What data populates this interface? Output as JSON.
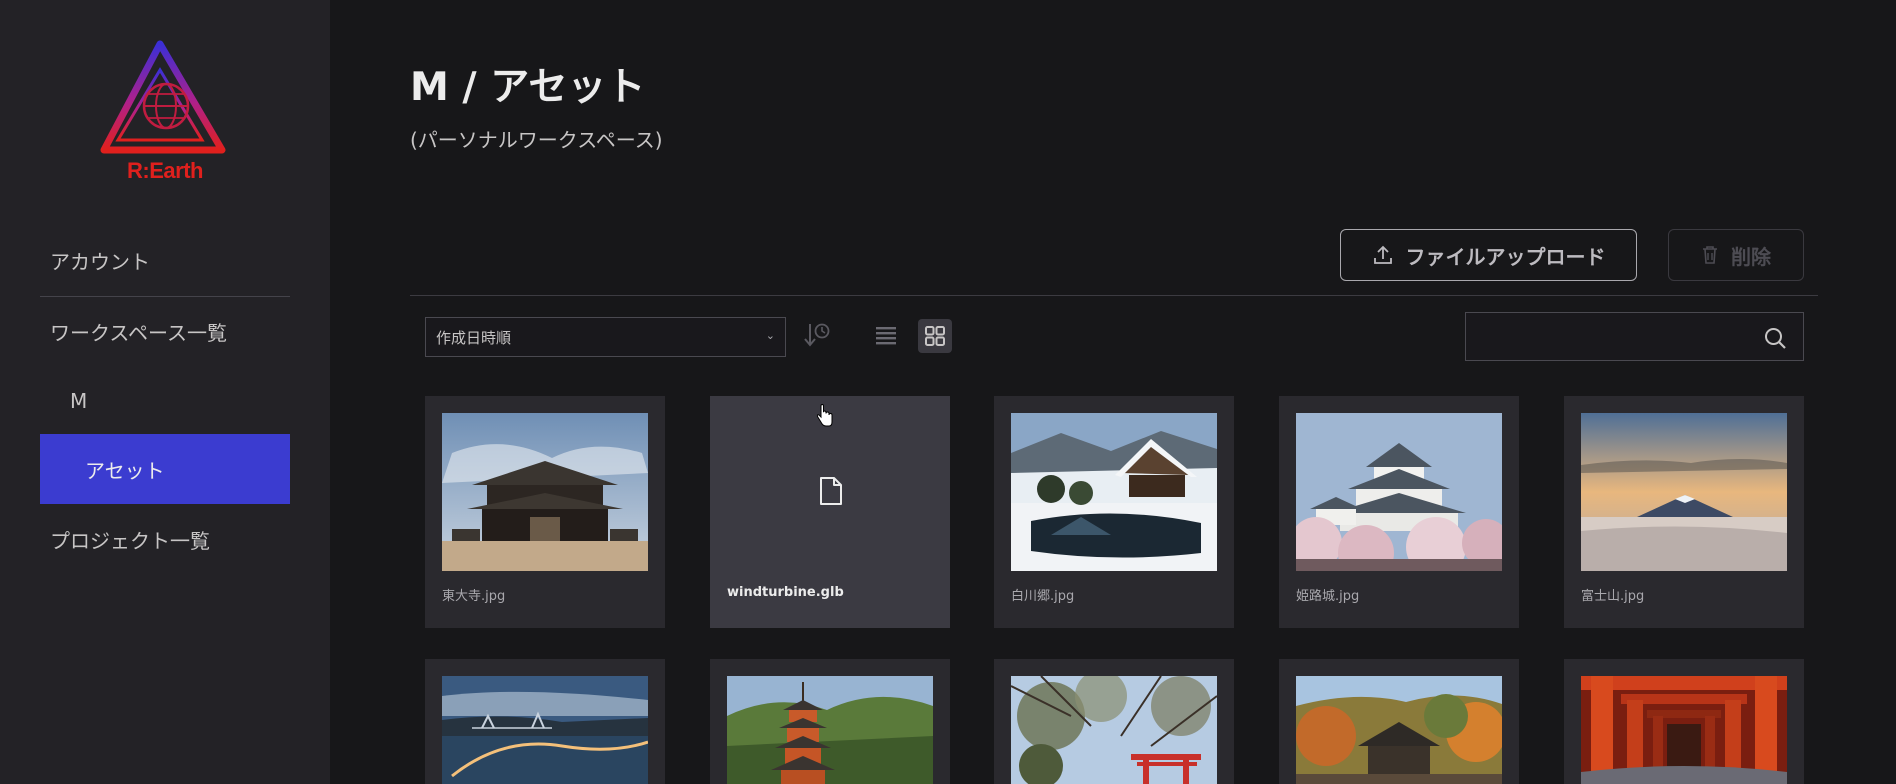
{
  "sidebar": {
    "logo_text": "R:Earth",
    "items": [
      {
        "label": "アカウント"
      },
      {
        "label": "ワークスペース一覧"
      },
      {
        "label": "M"
      },
      {
        "label": "アセット"
      },
      {
        "label": "プロジェクト一覧"
      }
    ]
  },
  "header": {
    "title": "M / アセット",
    "subtitle": "(パーソナルワークスペース)"
  },
  "actions": {
    "upload_label": "ファイルアップロード",
    "delete_label": "削除"
  },
  "toolbar": {
    "sort_value": "作成日時順",
    "search_value": ""
  },
  "assets": [
    {
      "name": "東大寺.jpg",
      "icon": "temple-photo"
    },
    {
      "name": "windturbine.glb",
      "icon": "file-icon"
    },
    {
      "name": "白川郷.jpg",
      "icon": "snow-village-photo"
    },
    {
      "name": "姫路城.jpg",
      "icon": "castle-photo"
    },
    {
      "name": "富士山.jpg",
      "icon": "mountain-photo"
    },
    {
      "name": "",
      "icon": "bridge-photo"
    },
    {
      "name": "",
      "icon": "pagoda-photo"
    },
    {
      "name": "",
      "icon": "shrine-gate-photo"
    },
    {
      "name": "",
      "icon": "autumn-temple-photo"
    },
    {
      "name": "",
      "icon": "torii-tunnel-photo"
    }
  ],
  "colors": {
    "sidebar_bg": "#232226",
    "main_bg": "#171719",
    "active_nav": "#3b3cd0",
    "logo_red": "#e0201d"
  }
}
